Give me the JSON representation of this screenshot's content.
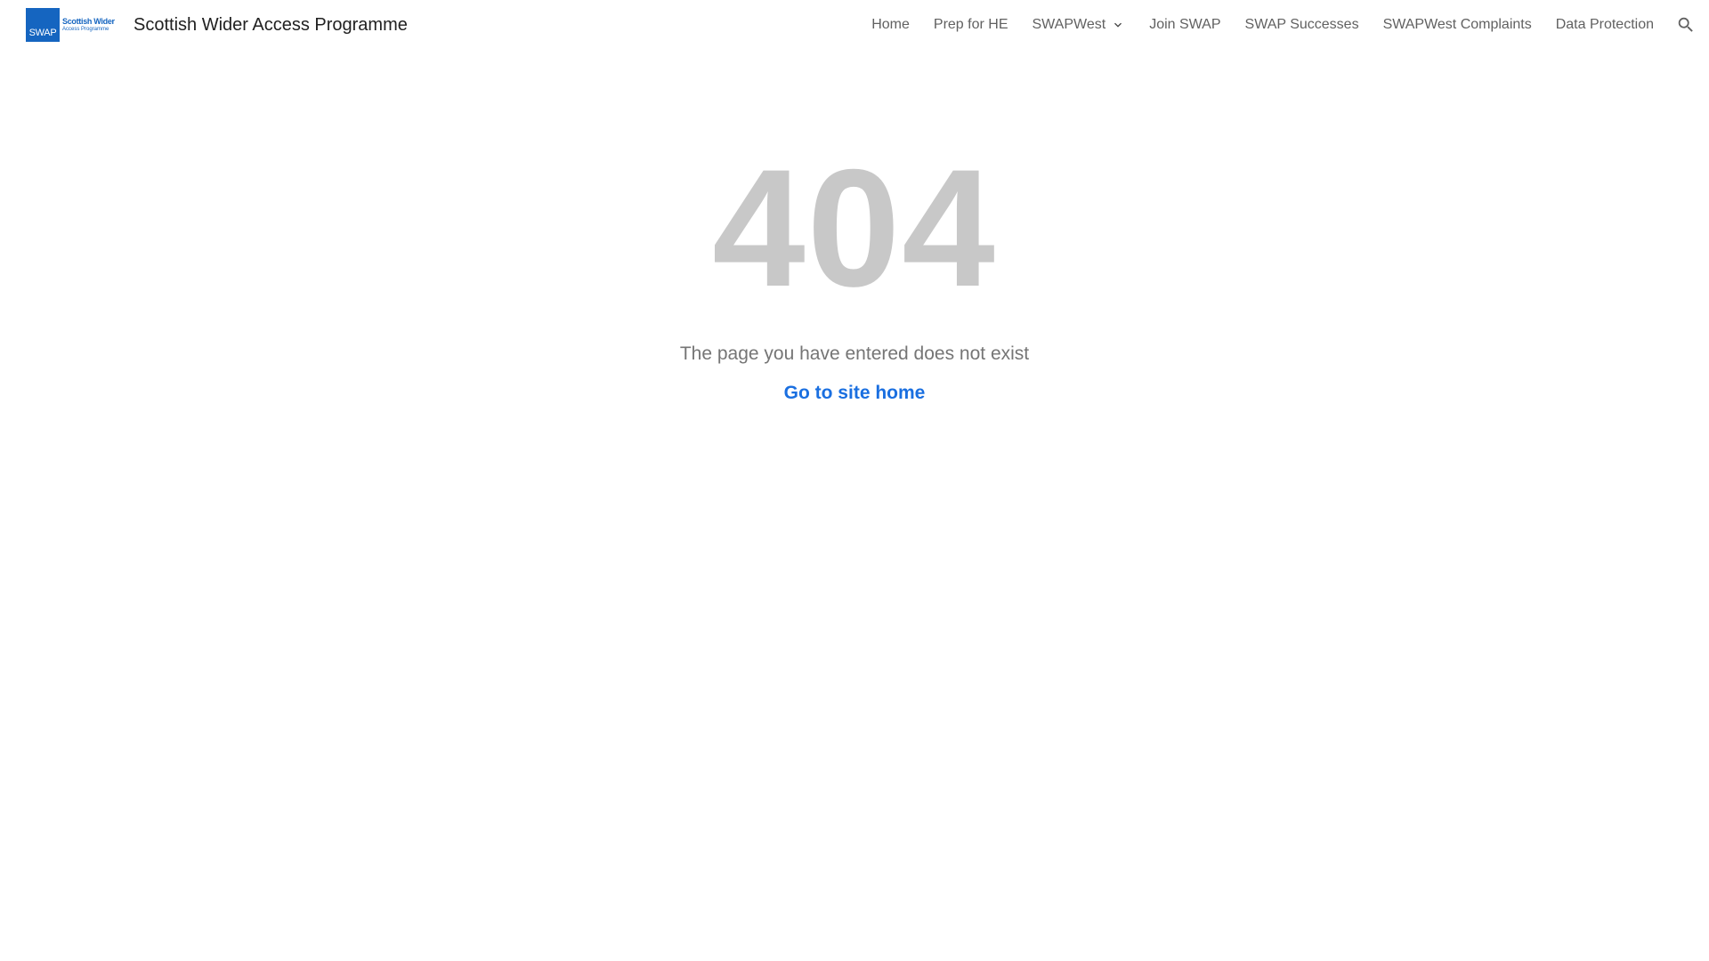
{
  "header": {
    "logo": {
      "box_text": "SWAP",
      "line1": "Scottish Wider",
      "line2": "Access Programme"
    },
    "site_title": "Scottish Wider Access Programme",
    "nav": {
      "home": "Home",
      "prep": "Prep for HE",
      "swapwest": "SWAPWest",
      "join": "Join SWAP",
      "successes": "SWAP Successes",
      "complaints": "SWAPWest Complaints",
      "data_protection": "Data Protection"
    },
    "icons": {
      "dropdown": "chevron-down-icon",
      "search": "search-icon"
    }
  },
  "error": {
    "code": "404",
    "message": "The page you have entered does not exist",
    "home_link": "Go to site home"
  },
  "colors": {
    "brand_blue": "#1565c0",
    "link_blue": "#1a6fe0",
    "code_gray": "#c8c8c8",
    "nav_text": "#616161"
  }
}
